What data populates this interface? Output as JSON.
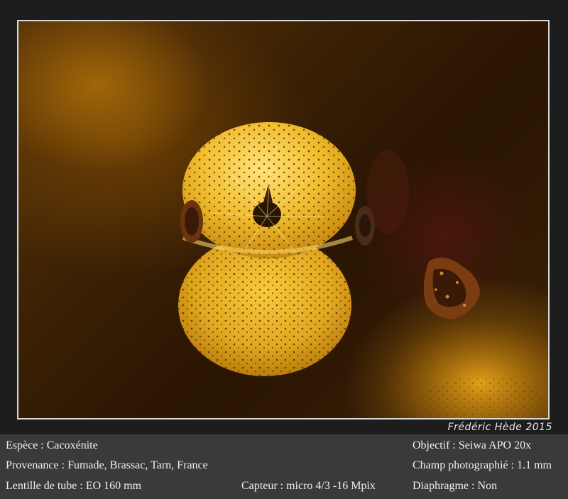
{
  "credit": "Frédéric Hède 2015",
  "caption": {
    "espece": "Espèce : Cacoxénite",
    "provenance": "Provenance : Fumade, Brassac, Tarn, France",
    "lentille": "Lentille de tube : EO 160 mm",
    "capteur": "Capteur : micro 4/3 -16 Mpix",
    "objectif": "Objectif : Seiwa APO 20x",
    "champ": "Champ photographié : 1.1 mm",
    "diaphragme": "Diaphragme : Non"
  },
  "colors": {
    "frame": "#1d1d1d",
    "caption_bg": "#3a3a3a",
    "crystal": "#f2c43a",
    "background": "#3a2004"
  }
}
